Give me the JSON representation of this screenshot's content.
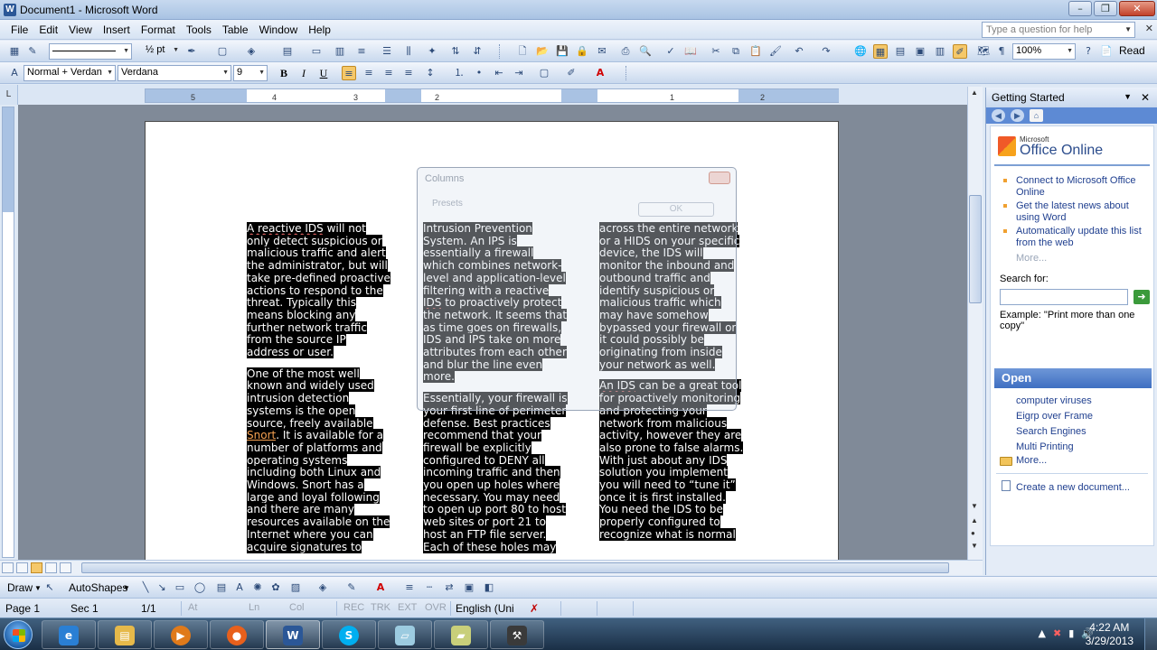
{
  "window": {
    "title": "Document1 - Microsoft Word",
    "app_icon": "W"
  },
  "menu": {
    "items": [
      "File",
      "Edit",
      "View",
      "Insert",
      "Format",
      "Tools",
      "Table",
      "Window",
      "Help"
    ],
    "help_placeholder": "Type a question for help"
  },
  "toolbar": {
    "line_weight": "½ pt",
    "zoom": "100%",
    "read_label": "Read"
  },
  "formatting": {
    "style": "Normal + Verdan",
    "font": "Verdana",
    "size": "9",
    "bold": "B",
    "italic": "I",
    "underline": "U"
  },
  "ruler": {
    "ticks": [
      "5",
      "4",
      "3",
      "2",
      "1",
      "2"
    ]
  },
  "ghost_dialog": {
    "title": "Columns",
    "presets": "Presets",
    "ok": "OK"
  },
  "document": {
    "columns": [
      [
        [
          {
            "t": "A reactive IDS",
            "spell": true
          },
          {
            "t": " will not only detect suspicious or malicious traffic and alert the administrator, but will take pre-defined proactive actions to respond to the threat. Typically this means blocking any further network traffic from the source IP address or user."
          }
        ],
        [
          {
            "t": "One of the most well known and widely used intrusion detection systems is the open source, freely available "
          },
          {
            "t": "Snort",
            "link": true
          },
          {
            "t": ". It is available for a number of platforms and operating systems including both Linux and Windows. Snort has a large and loyal following and there are many resources available on the Internet where you can acquire signatures to"
          }
        ]
      ],
      [
        [
          {
            "t": "Intrusion Prevention System. An IPS is essentially a firewall which combines network-level and application-level filtering with a reactive "
          },
          {
            "t": "IDS",
            "spell": true
          },
          {
            "t": " to proactively protect the network. It seems that as time goes on firewalls, IDS and IPS take on more attributes from each other and blur the line even more."
          }
        ],
        [
          {
            "t": "Essentially, your firewall is your first line of perimeter defense. Best practices recommend that your firewall be explicitly configured to DENY all incoming traffic and then you open up holes where necessary. You may need to open up port 80 to host web sites or port 21 to host an FTP file server. Each of these holes may"
          }
        ]
      ],
      [
        [
          {
            "t": "across the entire network or a HIDS on your specific device, the IDS will monitor the inbound and outbound traffic and identify suspicious or malicious traffic which may have somehow bypassed your firewall or it could possibly be originating from inside your network as well."
          }
        ],
        [
          {
            "t": "An IDS",
            "spell": true
          },
          {
            "t": " can be a great tool for proactively monitoring and protecting your network from malicious activity, however they are also prone to false alarms. With just about any IDS solution you implement you will need to “tune it” once it is first installed. You need the IDS to be properly configured to recognize what is normal"
          }
        ]
      ]
    ]
  },
  "taskpane": {
    "title": "Getting Started",
    "logo_small": "Microsoft",
    "logo": "Office Online",
    "links": [
      "Connect to Microsoft Office Online",
      "Get the latest news about using Word",
      "Automatically update this list from the web"
    ],
    "more1": "More...",
    "search_label": "Search for:",
    "example": "Example:  \"Print more than one copy\"",
    "open_title": "Open",
    "open_files": [
      "computer viruses",
      "Eigrp over Frame",
      "Search Engines",
      "Multi Printing"
    ],
    "more2": "More...",
    "create": "Create a new document..."
  },
  "drawbar": {
    "draw": "Draw",
    "autoshapes": "AutoShapes"
  },
  "status": {
    "page": "Page  1",
    "sec": "Sec  1",
    "pages": "1/1",
    "at": "At",
    "ln": "Ln",
    "col": "Col",
    "rec": "REC",
    "trk": "TRK",
    "ext": "EXT",
    "ovr": "OVR",
    "lang": "English (Uni"
  },
  "taskbar": {
    "time": "4:22 AM",
    "date": "3/29/2013"
  }
}
